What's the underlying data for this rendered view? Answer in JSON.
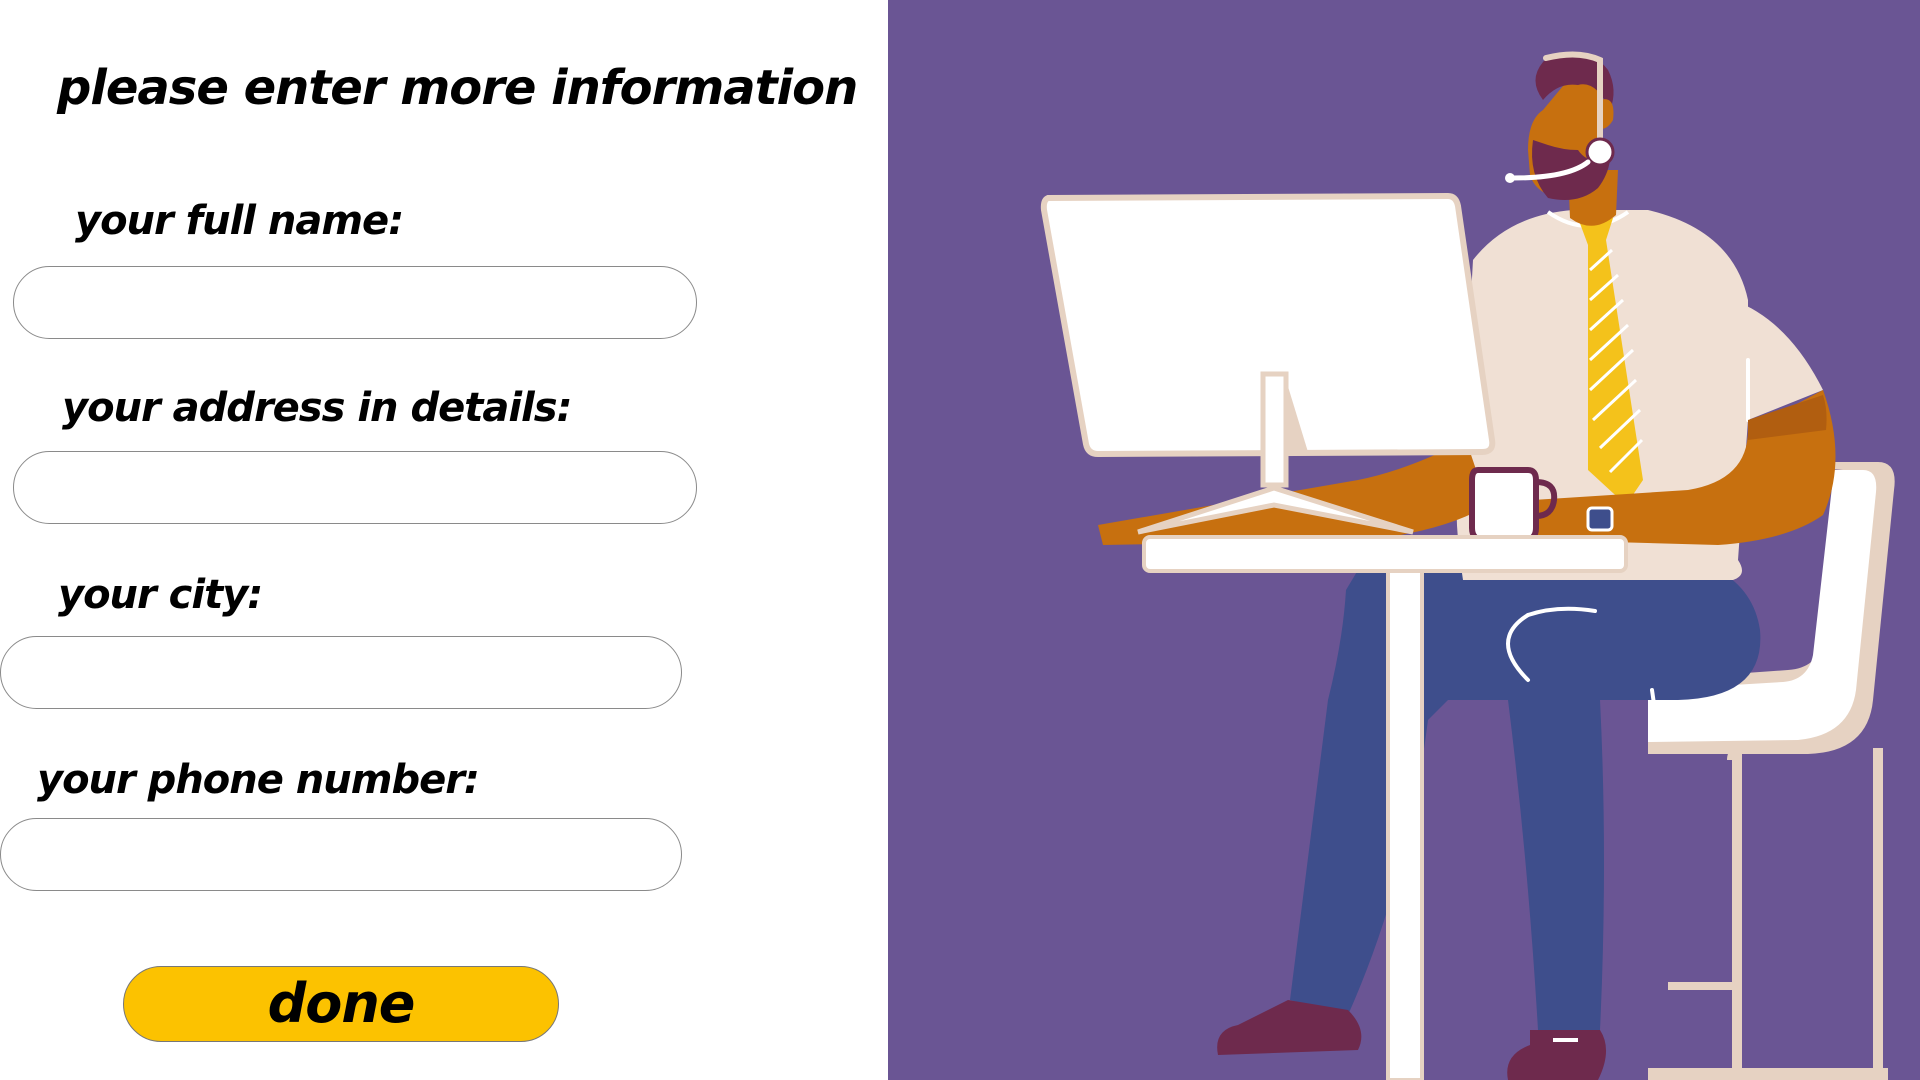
{
  "form": {
    "heading": "please enter more information",
    "fields": [
      {
        "label": "your full name:",
        "value": "",
        "placeholder": ""
      },
      {
        "label": "your address in details:",
        "value": "",
        "placeholder": ""
      },
      {
        "label": "your city:",
        "value": "",
        "placeholder": ""
      },
      {
        "label": "your phone number:",
        "value": "",
        "placeholder": ""
      }
    ],
    "submit_label": "done"
  },
  "colors": {
    "illustration_background": "#6a5594",
    "button_accent": "#fcc200",
    "input_border": "#8a8a8a",
    "text": "#000000"
  },
  "illustration": {
    "subject": "customer-support-agent-at-computer"
  }
}
